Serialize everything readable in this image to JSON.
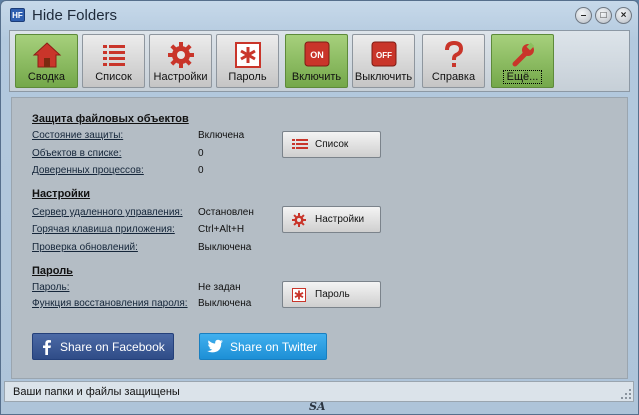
{
  "window": {
    "title": "Hide Folders",
    "icon_text": "HF"
  },
  "window_controls": {
    "minimize": "–",
    "maximize": "□",
    "close": "×"
  },
  "toolbar": {
    "items": [
      {
        "label": "Сводка",
        "icon": "home-icon",
        "active": true
      },
      {
        "label": "Список",
        "icon": "list-icon"
      },
      {
        "label": "Настройки",
        "icon": "gear-icon"
      },
      {
        "label": "Пароль",
        "icon": "asterisk-icon"
      },
      {
        "label": "Включить",
        "icon": "on-icon",
        "badge": "ON",
        "active": true
      },
      {
        "label": "Выключить",
        "icon": "off-icon",
        "badge": "OFF"
      },
      {
        "label": "Справка",
        "icon": "question-icon"
      },
      {
        "label": "Ещё...",
        "icon": "wrench-icon",
        "active": true
      }
    ]
  },
  "protection": {
    "title": "Защита файловых объектов",
    "rows": [
      {
        "label": "Состояние защиты:",
        "value": "Включена"
      },
      {
        "label": "Объектов в списке:",
        "value": "0"
      },
      {
        "label": "Доверенных процессов:",
        "value": "0"
      }
    ],
    "button": "Список"
  },
  "settings": {
    "title": "Настройки",
    "rows": [
      {
        "label": "Сервер удаленного управления:",
        "value": "Остановлен"
      },
      {
        "label": "Горячая клавиша приложения:",
        "value": "Ctrl+Alt+H"
      },
      {
        "label": "Проверка обновлений:",
        "value": "Выключена"
      }
    ],
    "button": "Настройки"
  },
  "password": {
    "title": "Пароль",
    "rows": [
      {
        "label": "Пароль:",
        "value": "Не задан"
      },
      {
        "label": "Функция восстановления пароля:",
        "value": "Выключена"
      }
    ],
    "button": "Пароль"
  },
  "share": {
    "facebook": "Share on Facebook",
    "twitter": "Share on Twitter"
  },
  "status": {
    "text": "Ваши папки и файлы защищены"
  },
  "watermark": "SA",
  "colors": {
    "accent_green": "#8cbf5e",
    "facebook": "#3b5998",
    "twitter": "#2aa0e6",
    "icon_red": "#c9352a"
  }
}
